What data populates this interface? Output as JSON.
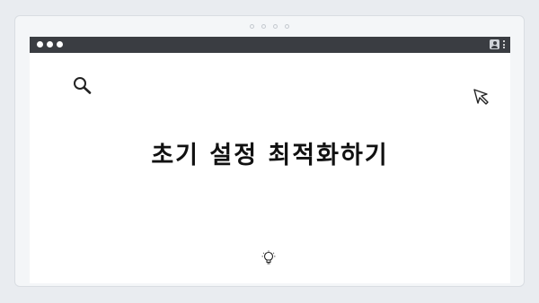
{
  "window": {
    "title_dots": [
      "close",
      "minimize",
      "maximize"
    ]
  },
  "content": {
    "headline": "초기 설정 최적화하기"
  },
  "icons": {
    "search": "search-icon",
    "cursor": "cursor-arrow-icon",
    "lightbulb": "lightbulb-icon",
    "user": "user-icon",
    "menu": "kebab-menu-icon"
  }
}
